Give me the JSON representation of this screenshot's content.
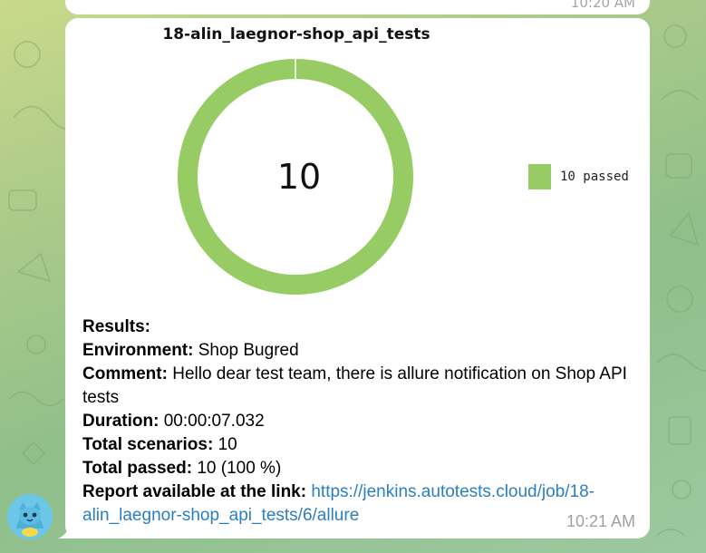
{
  "previous_message": {
    "time": "10:20 AM"
  },
  "message": {
    "time": "10:21 AM",
    "chart_title": "18-alin_laegnor-shop_api_tests",
    "chart_data": {
      "type": "pie",
      "title": "18-alin_laegnor-shop_api_tests",
      "center_label": "10",
      "slices": [
        {
          "label": "10 passed",
          "value": 10,
          "color": "#97cc64"
        }
      ],
      "legend_position": "right"
    },
    "lines": {
      "results_label": "Results:",
      "environment_label": "Environment:",
      "environment_value": " Shop Bugred",
      "comment_label": "Comment:",
      "comment_value": " Hello dear test team, there is allure notification on Shop API tests",
      "duration_label": "Duration:",
      "duration_value": " 00:00:07.032",
      "total_scenarios_label": "Total scenarios:",
      "total_scenarios_value": " 10",
      "total_passed_label": "Total passed:",
      "total_passed_value": " 10 (100 %)",
      "report_label": "Report available at the link:",
      "report_link": "https://jenkins.autotests.cloud/job/18-alin_laegnor-shop_api_tests/6/allure"
    }
  },
  "colors": {
    "passed": "#97cc64",
    "link": "#2b7fc0",
    "bubble": "#ffffff",
    "avatar": "#6cc6e8"
  },
  "icons": {
    "avatar": "cat-avatar-icon"
  }
}
